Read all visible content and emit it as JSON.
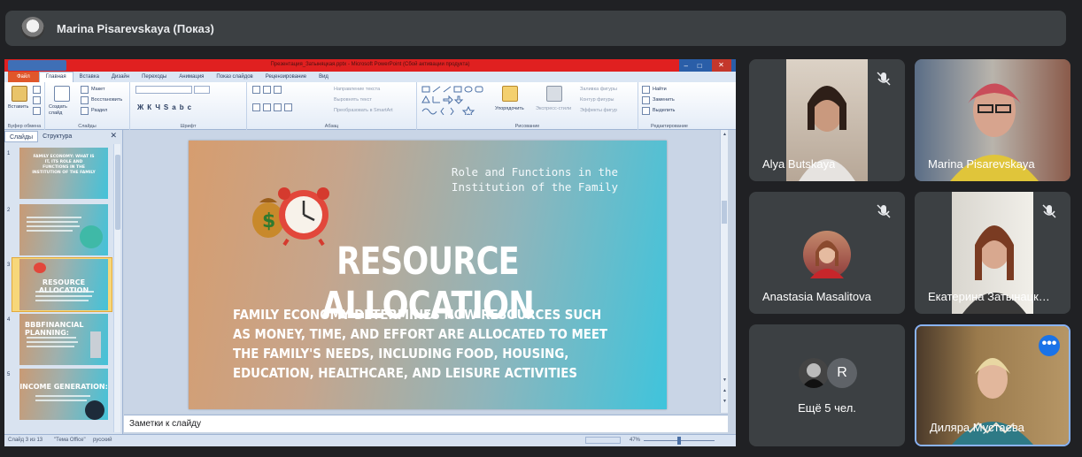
{
  "presenter": {
    "name": "Marina Pisarevskaya (Показ)"
  },
  "powerpoint": {
    "window_title": "Презентация_Затыняцкая.pptx - Microsoft PowerPoint (Сбой активации продукта)",
    "tabs": {
      "file": "Файл",
      "items": [
        "Главная",
        "Вставка",
        "Дизайн",
        "Переходы",
        "Анимация",
        "Показ слайдов",
        "Рецензирование",
        "Вид"
      ]
    },
    "ribbon": {
      "clipboard": {
        "paste": "Вставить",
        "label": "Буфер обмена"
      },
      "slides": {
        "new_slide": "Создать слайд",
        "layout": "Макет",
        "reset": "Восстановить",
        "section": "Раздел",
        "label": "Слайды"
      },
      "font": {
        "label": "Шрифт"
      },
      "paragraph": {
        "text_direction": "Направление текста",
        "align_text": "Выровнять текст",
        "smartart": "Преобразовать в SmartArt",
        "label": "Абзац"
      },
      "drawing": {
        "arrange": "Упорядочить",
        "quick_styles": "Экспресс-стили",
        "fill": "Заливка фигуры",
        "outline": "Контур фигуры",
        "effects": "Эффекты фигур",
        "label": "Рисование"
      },
      "editing": {
        "find": "Найти",
        "replace": "Заменить",
        "select": "Выделить",
        "label": "Редактирование"
      }
    },
    "panel_tabs": {
      "slides": "Слайды",
      "outline": "Структура"
    },
    "thumbnails": [
      {
        "num": "1",
        "title": "FAMILY ECONOMY: WHAT IS IT, ITS ROLE AND FUNCTIONS IN THE INSTITUTION OF THE FAMILY"
      },
      {
        "num": "2",
        "title": ""
      },
      {
        "num": "3",
        "title": "RESOURCE ALLOCATION"
      },
      {
        "num": "4",
        "title": "BBBFINANCIAL PLANNING:"
      },
      {
        "num": "5",
        "title": "INCOME GENERATION:"
      }
    ],
    "slide": {
      "subtitle": "Role and Functions in the Institution of the Family",
      "title": "RESOURCE ALLOCATION",
      "body": [
        "FAMILY ECONOMY DETERMINES HOW RESOURCES SUCH",
        "AS MONEY, TIME, AND EFFORT ARE ALLOCATED TO MEET",
        "THE FAMILY'S NEEDS, INCLUDING FOOD, HOUSING,",
        "EDUCATION, HEALTHCARE, AND LEISURE ACTIVITIES"
      ]
    },
    "notes_placeholder": "Заметки к слайду",
    "status": {
      "slide_info": "Слайд 3 из 13",
      "theme": "\"Тема Office\"",
      "language": "русский",
      "zoom": "47%"
    }
  },
  "participants": [
    {
      "name": "Alya Butskaya",
      "muted": true
    },
    {
      "name": "Marina Pisarevskaya",
      "muted": false
    },
    {
      "name": "Anastasia Masalitova",
      "muted": true
    },
    {
      "name": "Екатерина Затынацк…",
      "muted": true
    },
    {
      "name": "Ещё 5 чел.",
      "avatar_letter": "R"
    },
    {
      "name": "Диляра Мустаева",
      "more_button": "•••"
    }
  ],
  "colors": {
    "meet_bg": "#202124",
    "tile_bg": "#3c4043",
    "accent": "#1a73e8",
    "ppt_titlebar": "#e02020"
  }
}
